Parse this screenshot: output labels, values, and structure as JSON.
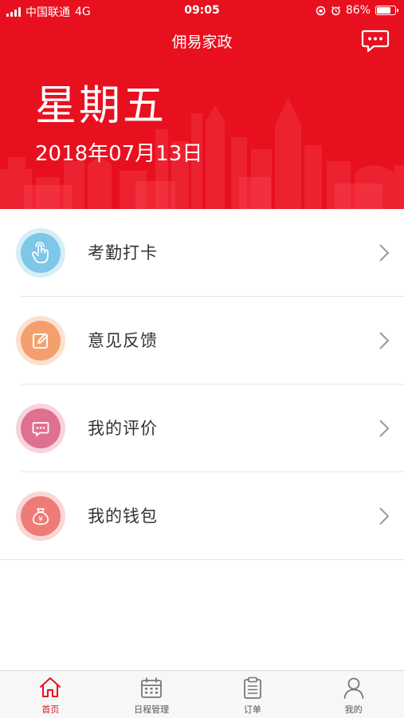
{
  "status_bar": {
    "carrier": "中国联通",
    "network": "4G",
    "time": "09:05",
    "battery": "86%",
    "battery_level": 0.86
  },
  "header": {
    "title": "佣易家政",
    "weekday": "星期五",
    "date": "2018年07月13日",
    "bg_color": "#e8101f"
  },
  "menu": {
    "items": [
      {
        "label": "考勤打卡",
        "icon": "touch-icon",
        "color": "#7ec7e8",
        "ring": "#d6eef8"
      },
      {
        "label": "意见反馈",
        "icon": "edit-icon",
        "color": "#f3a06e",
        "ring": "#fbe1d0"
      },
      {
        "label": "我的评价",
        "icon": "comment-icon",
        "color": "#e0708f",
        "ring": "#f6d3dd"
      },
      {
        "label": "我的钱包",
        "icon": "money-bag-icon",
        "color": "#ee7b78",
        "ring": "#fad7d6"
      }
    ]
  },
  "tabs": [
    {
      "label": "首页",
      "icon": "home-icon",
      "active": true
    },
    {
      "label": "日程管理",
      "icon": "calendar-icon",
      "active": false
    },
    {
      "label": "订单",
      "icon": "clipboard-icon",
      "active": false
    },
    {
      "label": "我的",
      "icon": "user-icon",
      "active": false
    }
  ]
}
